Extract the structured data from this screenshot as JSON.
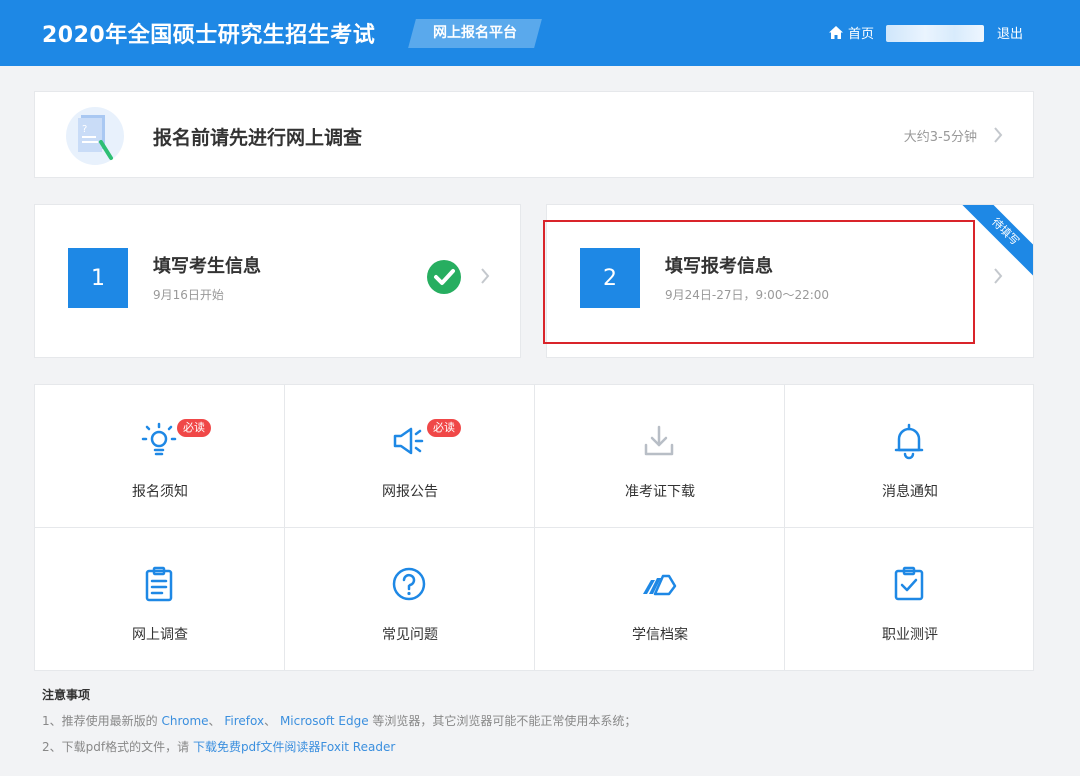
{
  "header": {
    "title": "2020年全国硕士研究生招生考试",
    "platform": "网上报名平台",
    "home": "首页",
    "logout": "退出"
  },
  "survey": {
    "label": "报名前请先进行网上调查",
    "time": "大约3-5分钟"
  },
  "steps": [
    {
      "number": "1",
      "title": "填写考生信息",
      "subtitle": "9月16日开始",
      "status": "completed"
    },
    {
      "number": "2",
      "title": "填写报考信息",
      "subtitle": "9月24日-27日，9:00～22:00",
      "ribbon": "待填写"
    }
  ],
  "grid": [
    {
      "label": "报名须知",
      "icon": "lightbulb-icon",
      "badge": "必读"
    },
    {
      "label": "网报公告",
      "icon": "megaphone-icon",
      "badge": "必读"
    },
    {
      "label": "准考证下载",
      "icon": "download-icon"
    },
    {
      "label": "消息通知",
      "icon": "bell-icon"
    },
    {
      "label": "网上调查",
      "icon": "clipboard-icon"
    },
    {
      "label": "常见问题",
      "icon": "question-icon"
    },
    {
      "label": "学信档案",
      "icon": "folder-icon"
    },
    {
      "label": "职业测评",
      "icon": "clipboard-check-icon"
    }
  ],
  "notes": {
    "title": "注意事项",
    "line1_prefix": "1、推荐使用最新版的",
    "browser1": "Chrome",
    "sep1": "、",
    "browser2": "Firefox",
    "sep2": "、",
    "browser3": "Microsoft Edge",
    "line1_suffix": "等浏览器，其它浏览器可能不能正常使用本系统；",
    "line2_prefix": "2、下载pdf格式的文件，请",
    "reader_link": "下载免费pdf文件阅读器Foxit Reader"
  },
  "colors": {
    "primary": "#1e88e5",
    "highlight": "#d9242a",
    "badge": "#f04848",
    "success": "#27ae60",
    "disabled": "#b8bec6"
  }
}
